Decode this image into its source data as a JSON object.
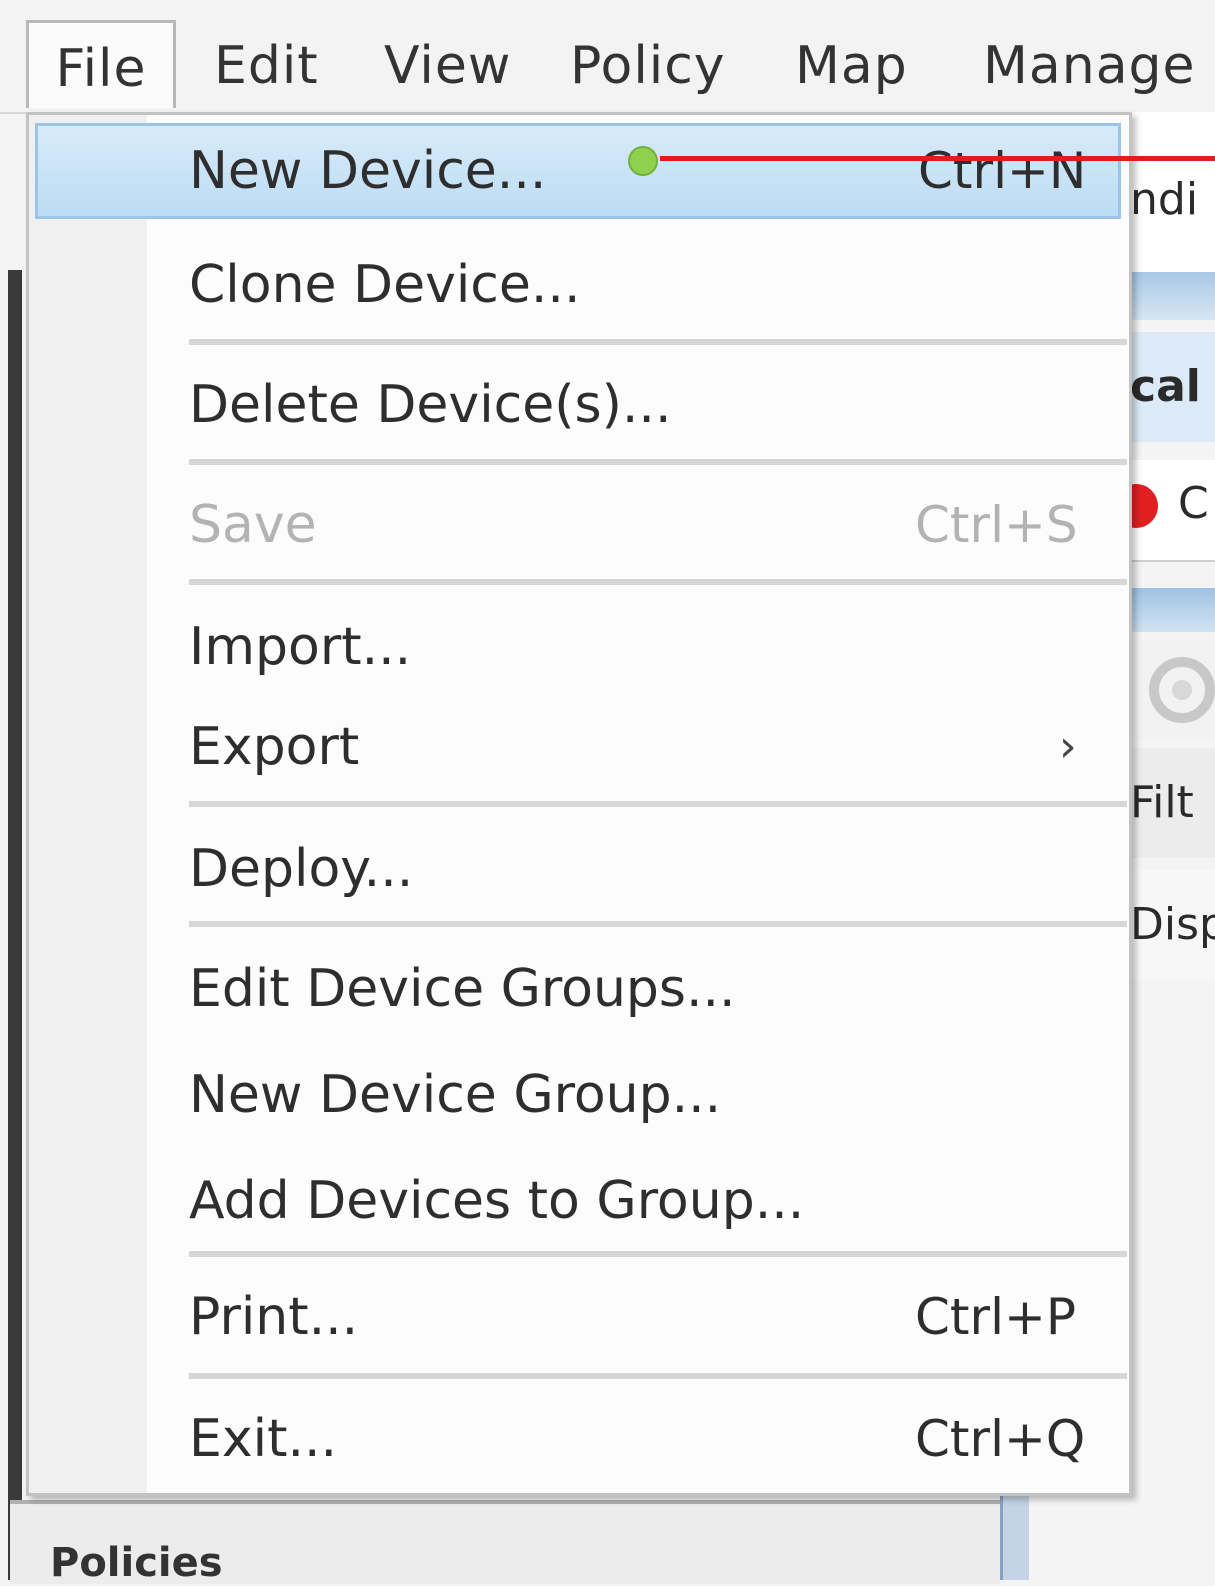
{
  "menubar": {
    "items": [
      "File",
      "Edit",
      "View",
      "Policy",
      "Map",
      "Manage"
    ]
  },
  "file_menu": {
    "new_device": {
      "label": "New Device...",
      "shortcut": "Ctrl+N"
    },
    "clone_device": {
      "label": "Clone Device..."
    },
    "delete_devices": {
      "label": "Delete Device(s)..."
    },
    "save": {
      "label": "Save",
      "shortcut": "Ctrl+S"
    },
    "import": {
      "label": "Import..."
    },
    "export": {
      "label": "Export",
      "submenu_glyph": "›"
    },
    "deploy": {
      "label": "Deploy..."
    },
    "edit_device_groups": {
      "label": "Edit Device Groups..."
    },
    "new_device_group": {
      "label": "New Device Group..."
    },
    "add_devices_to_group": {
      "label": "Add Devices to Group..."
    },
    "print": {
      "label": "Print...",
      "shortcut": "Ctrl+P"
    },
    "exit": {
      "label": "Exit...",
      "shortcut": "Ctrl+Q"
    }
  },
  "background": {
    "fragment_top": "ndi",
    "fragment_bold": "cal",
    "fragment_status": "C",
    "fragment_filter": "Filt",
    "fragment_display": "Disp",
    "policies_label": "Policies"
  },
  "colors": {
    "highlight": "#bcdcf4",
    "pointer": "#e21b1b",
    "pointer_dot": "#8fd14f",
    "status_red": "#e02020"
  }
}
